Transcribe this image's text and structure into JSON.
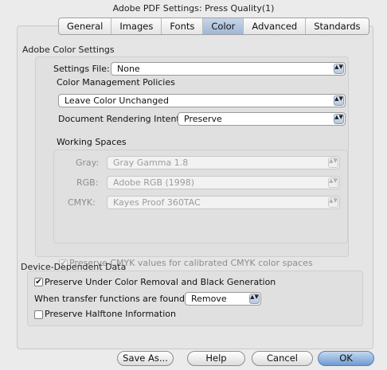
{
  "window": {
    "title": "Adobe PDF Settings: Press Quality(1)"
  },
  "tabs": [
    "General",
    "Images",
    "Fonts",
    "Color",
    "Advanced",
    "Standards"
  ],
  "active_tab": "Color",
  "color_settings": {
    "section_label": "Adobe Color Settings",
    "settings_file_label": "Settings File:",
    "settings_file_value": "None",
    "policies_label": "Color Management Policies",
    "policy_value": "Leave Color Unchanged",
    "rendering_intent_label": "Document Rendering Intent:",
    "rendering_intent_value": "Preserve",
    "working_spaces_label": "Working Spaces",
    "gray_label": "Gray:",
    "gray_value": "Gray Gamma 1.8",
    "rgb_label": "RGB:",
    "rgb_value": "Adobe RGB (1998)",
    "cmyk_label": "CMYK:",
    "cmyk_value": "Kayes Proof 360TAC",
    "preserve_cmyk_label": "Preserve CMYK values for calibrated CMYK color spaces",
    "preserve_cmyk_checked": true
  },
  "device_data": {
    "section_label": "Device-Dependent Data",
    "preserve_ucr_label": "Preserve Under Color Removal and Black Generation",
    "preserve_ucr_checked": true,
    "transfer_label": "When transfer functions are found:",
    "transfer_value": "Remove",
    "halftone_label": "Preserve Halftone Information",
    "halftone_checked": false
  },
  "buttons": {
    "save_as": "Save As...",
    "help": "Help",
    "cancel": "Cancel",
    "ok": "OK"
  },
  "glyphs": {
    "stepper": "▲▼",
    "check": "✔"
  }
}
